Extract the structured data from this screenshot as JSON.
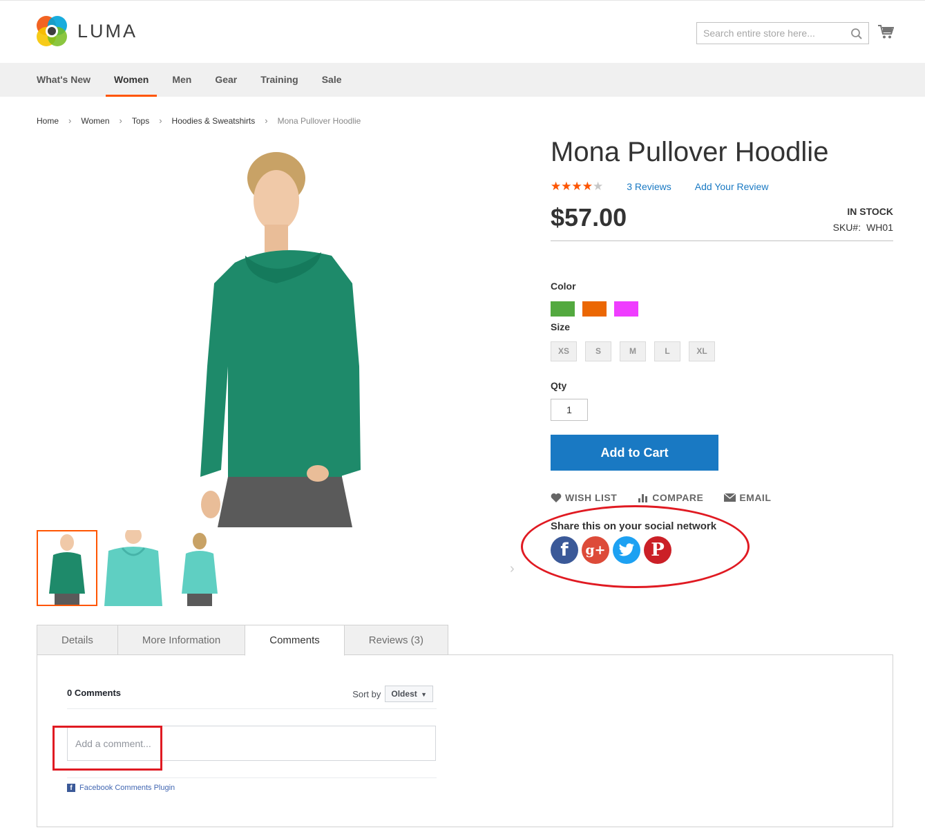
{
  "brand": {
    "name": "LUMA"
  },
  "search": {
    "placeholder": "Search entire store here..."
  },
  "nav": {
    "items": [
      "What's New",
      "Women",
      "Men",
      "Gear",
      "Training",
      "Sale"
    ],
    "active": "Women"
  },
  "breadcrumb": [
    "Home",
    "Women",
    "Tops",
    "Hoodies & Sweatshirts",
    "Mona Pullover Hoodlie"
  ],
  "product": {
    "title": "Mona Pullover Hoodlie",
    "rating_fraction": 0.8,
    "reviews_link": "3 Reviews",
    "add_review": "Add Your Review",
    "price": "$57.00",
    "stock": "IN STOCK",
    "sku_label": "SKU#:",
    "sku": "WH01",
    "color_label": "Color",
    "colors": [
      "#53a93f",
      "#eb6703",
      "#ef3dff"
    ],
    "size_label": "Size",
    "sizes": [
      "XS",
      "S",
      "M",
      "L",
      "XL"
    ],
    "qty_label": "Qty",
    "qty": "1",
    "add_to_cart": "Add to Cart",
    "actions": {
      "wishlist": "WISH LIST",
      "compare": "COMPARE",
      "email": "EMAIL"
    }
  },
  "share": {
    "title": "Share this on your social network"
  },
  "tabs": [
    "Details",
    "More Information",
    "Comments",
    "Reviews (3)"
  ],
  "active_tab": "Comments",
  "comments": {
    "count": "0 Comments",
    "sort_label": "Sort by",
    "sort_value": "Oldest",
    "placeholder": "Add a comment...",
    "plugin": "Facebook Comments Plugin"
  },
  "colors": {
    "accent": "#ff5501",
    "primary": "#1979c3",
    "annotation": "#e01a22"
  }
}
